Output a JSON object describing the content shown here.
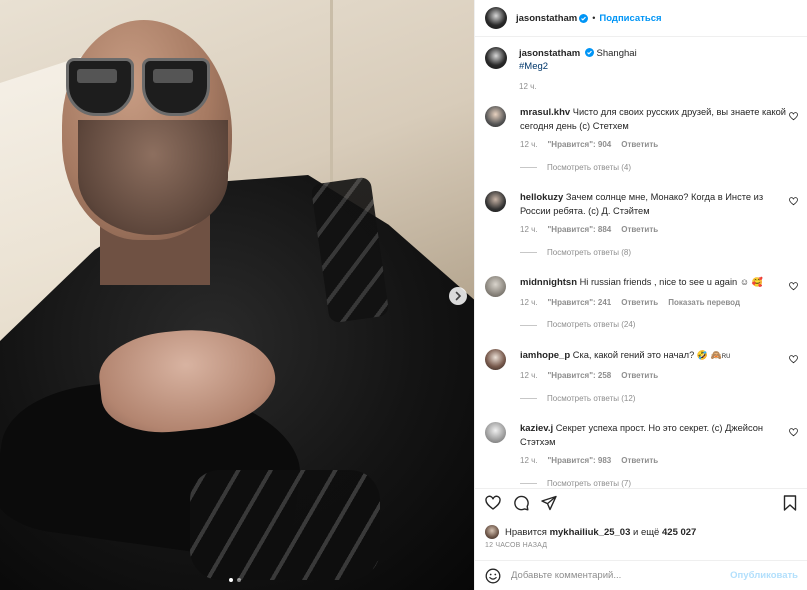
{
  "post": {
    "photo_alt": "",
    "carousel": {
      "current": 1,
      "total": 2
    }
  },
  "header": {
    "username": "jasonstatham",
    "separator": "•",
    "follow_label": "Подписаться"
  },
  "caption": {
    "username": "jasonstatham",
    "location": "Shanghai",
    "hashtag": "#Meg2",
    "time": "12 ч."
  },
  "comments": [
    {
      "user": "mrasul.khv",
      "text": "Чисто для своих русских друзей, вы знаете какой сегодня день (с) Стетхем",
      "time": "12 ч.",
      "likes": "\"Нравится\": 904",
      "reply": "Ответить",
      "extra": "",
      "replies": "Посмотреть ответы (4)"
    },
    {
      "user": "hellokuzy",
      "text": "Зачем солнце мне, Монако? Когда в Инсте из России ребята. (с) Д. Стэйтем",
      "time": "12 ч.",
      "likes": "\"Нравится\": 884",
      "reply": "Ответить",
      "extra": "",
      "replies": "Посмотреть ответы (8)"
    },
    {
      "user": "midnnightsn",
      "text": "Hi russian friends , nice to see u again",
      "emoji": "☺ 🥰",
      "time": "12 ч.",
      "likes": "\"Нравится\": 241",
      "reply": "Ответить",
      "extra": "Показать перевод",
      "replies": "Посмотреть ответы (24)"
    },
    {
      "user": "iamhope_p",
      "text": "Ска, какой гений это начал?",
      "emoji": "🤣 🙈",
      "suffix": "RU",
      "time": "12 ч.",
      "likes": "\"Нравится\": 258",
      "reply": "Ответить",
      "extra": "",
      "replies": "Посмотреть ответы (12)"
    },
    {
      "user": "kaziev.j",
      "text": "Секрет успеха прост. Но это секрет. (с) Джейсон Стэтхэм",
      "time": "12 ч.",
      "likes": "\"Нравится\": 983",
      "reply": "Ответить",
      "extra": "",
      "replies": "Посмотреть ответы (7)"
    }
  ],
  "likes": {
    "prefix": "Нравится",
    "user": "mykhailiuk_25_03",
    "middle": "и ещё",
    "count": "425 027"
  },
  "posted_ago": "12 ЧАСОВ НАЗАД",
  "add_comment": {
    "placeholder": "Добавьте комментарий...",
    "post_label": "Опубликовать"
  },
  "icons": {
    "verified": "verified-badge-icon",
    "like": "heart-icon",
    "comment": "comment-icon",
    "share": "share-icon",
    "save": "bookmark-icon",
    "emoji": "smiley-icon",
    "next": "chevron-right-icon"
  },
  "colors": {
    "link": "#0095f6",
    "hashtag": "#00376b",
    "muted": "#8e8e8e",
    "post_disabled": "#b2dffc"
  }
}
